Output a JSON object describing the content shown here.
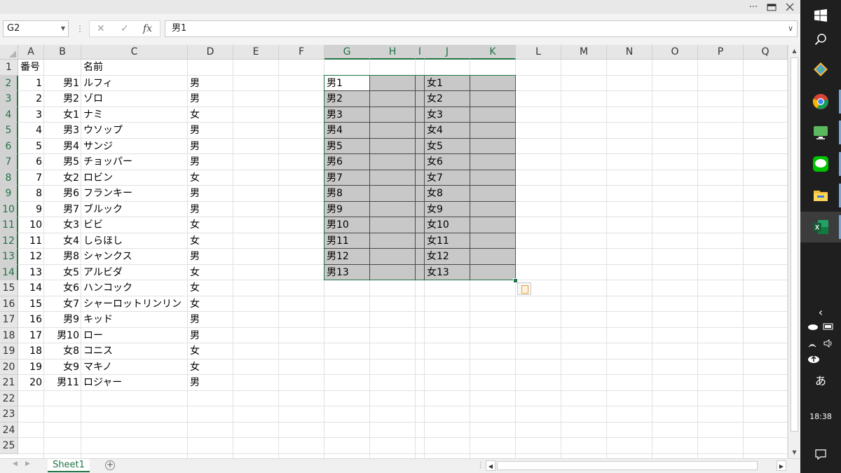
{
  "window": {
    "more_label": "···"
  },
  "formula_bar": {
    "name_box": "G2",
    "cancel_icon": "✕",
    "enter_icon": "✓",
    "fx_label": "fx",
    "formula_value": "男1"
  },
  "columns": [
    "A",
    "B",
    "C",
    "D",
    "E",
    "F",
    "G",
    "H",
    "I",
    "J",
    "K",
    "L",
    "M",
    "N",
    "O",
    "P",
    "Q"
  ],
  "rows": [
    "1",
    "2",
    "3",
    "4",
    "5",
    "6",
    "7",
    "8",
    "9",
    "10",
    "11",
    "12",
    "13",
    "14",
    "15",
    "16",
    "17",
    "18",
    "19",
    "20",
    "21",
    "22",
    "23",
    "24",
    "25"
  ],
  "header_row": {
    "a": "番号",
    "c": "名前"
  },
  "data_rows": [
    {
      "num": "1",
      "code": "男1",
      "name": "ルフィ",
      "gender": "男"
    },
    {
      "num": "2",
      "code": "男2",
      "name": "ゾロ",
      "gender": "男"
    },
    {
      "num": "3",
      "code": "女1",
      "name": "ナミ",
      "gender": "女"
    },
    {
      "num": "4",
      "code": "男3",
      "name": "ウソップ",
      "gender": "男"
    },
    {
      "num": "5",
      "code": "男4",
      "name": "サンジ",
      "gender": "男"
    },
    {
      "num": "6",
      "code": "男5",
      "name": "チョッパー",
      "gender": "男"
    },
    {
      "num": "7",
      "code": "女2",
      "name": "ロビン",
      "gender": "女"
    },
    {
      "num": "8",
      "code": "男6",
      "name": "フランキー",
      "gender": "男"
    },
    {
      "num": "9",
      "code": "男7",
      "name": "ブルック",
      "gender": "男"
    },
    {
      "num": "10",
      "code": "女3",
      "name": "ビビ",
      "gender": "女"
    },
    {
      "num": "11",
      "code": "女4",
      "name": "しらほし",
      "gender": "女"
    },
    {
      "num": "12",
      "code": "男8",
      "name": "シャンクス",
      "gender": "男"
    },
    {
      "num": "13",
      "code": "女5",
      "name": "アルビダ",
      "gender": "女"
    },
    {
      "num": "14",
      "code": "女6",
      "name": "ハンコック",
      "gender": "女"
    },
    {
      "num": "15",
      "code": "女7",
      "name": "シャーロットリンリン",
      "gender": "女"
    },
    {
      "num": "16",
      "code": "男9",
      "name": "キッド",
      "gender": "男"
    },
    {
      "num": "17",
      "code": "男10",
      "name": "ロー",
      "gender": "男"
    },
    {
      "num": "18",
      "code": "女8",
      "name": "コニス",
      "gender": "女"
    },
    {
      "num": "19",
      "code": "女9",
      "name": "マキノ",
      "gender": "女"
    },
    {
      "num": "20",
      "code": "男11",
      "name": "ロジャー",
      "gender": "男"
    }
  ],
  "groups": {
    "male": [
      "男1",
      "男2",
      "男3",
      "男4",
      "男5",
      "男6",
      "男7",
      "男8",
      "男9",
      "男10",
      "男11",
      "男12",
      "男13"
    ],
    "female": [
      "女1",
      "女2",
      "女3",
      "女4",
      "女5",
      "女6",
      "女7",
      "女8",
      "女9",
      "女10",
      "女11",
      "女12",
      "女13"
    ]
  },
  "sheet_tabs": [
    "Sheet1"
  ],
  "add_sheet_label": "⊕",
  "taskbar": {
    "ime_label": "あ",
    "clock": "18:38"
  },
  "colors": {
    "excel_green": "#217346",
    "selection_fill": "#c8c8c8",
    "taskbar": "#1f1f1f"
  }
}
